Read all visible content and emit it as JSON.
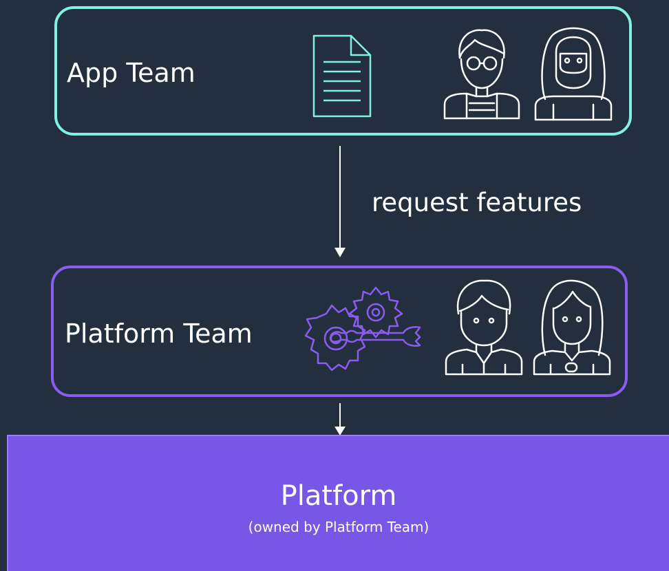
{
  "app_team": {
    "label": "App Team",
    "icons": [
      "document-icon",
      "developer-with-glasses-icon",
      "developer-with-headscarf-icon"
    ]
  },
  "connector_1": {
    "label": "request features"
  },
  "platform_team": {
    "label": "Platform Team",
    "icons": [
      "gears-wrench-icon",
      "engineer-icon",
      "engineer-woman-icon"
    ]
  },
  "platform": {
    "title": "Platform",
    "subtitle": "(owned by Platform Team)"
  },
  "colors": {
    "background": "#232f3e",
    "app_border": "#7ff2e0",
    "platform_team_border": "#8c5cf0",
    "platform_fill": "#7856e6"
  }
}
